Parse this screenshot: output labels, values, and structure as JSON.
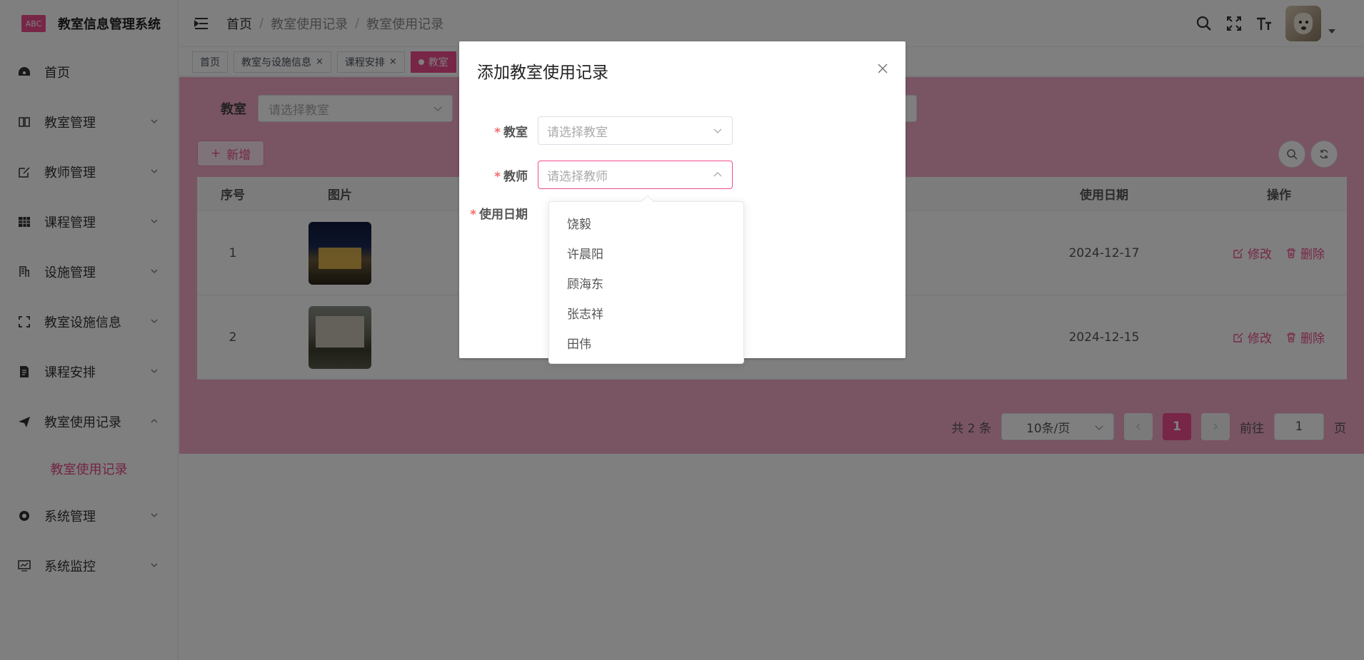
{
  "app": {
    "logo_text": "ABC",
    "title": "教室信息管理系统"
  },
  "sidebar": {
    "items": [
      {
        "label": "首页",
        "icon": "dashboard-icon"
      },
      {
        "label": "教室管理",
        "icon": "book-icon"
      },
      {
        "label": "教师管理",
        "icon": "edit-icon"
      },
      {
        "label": "课程管理",
        "icon": "grid-icon"
      },
      {
        "label": "设施管理",
        "icon": "building-icon"
      },
      {
        "label": "教室设施信息",
        "icon": "fullscreen-icon"
      },
      {
        "label": "课程安排",
        "icon": "document-icon"
      },
      {
        "label": "教室使用记录",
        "icon": "paper-plane-icon"
      },
      {
        "label": "系统管理",
        "icon": "gear-icon"
      },
      {
        "label": "系统监控",
        "icon": "monitor-icon"
      }
    ],
    "submenu_active": "教室使用记录"
  },
  "header": {
    "breadcrumb": [
      "首页",
      "/",
      "教室使用记录",
      "/",
      "教室使用记录"
    ]
  },
  "tags": [
    {
      "label": "首页"
    },
    {
      "label": "教室与设施信息",
      "close": "×"
    },
    {
      "label": "课程安排",
      "close": "×"
    },
    {
      "label": "教室",
      "active": true
    }
  ],
  "filter": {
    "label": "教室",
    "placeholder": "请选择教室"
  },
  "toolbar": {
    "add_label": "新增",
    "add_prefix": "+"
  },
  "table": {
    "headers": {
      "index": "序号",
      "image": "图片",
      "date": "使用日期",
      "ops": "操作"
    },
    "rows": [
      {
        "index": "1",
        "date": "2024-12-17"
      },
      {
        "index": "2",
        "date": "2024-12-15"
      }
    ],
    "edit_label": "修改",
    "delete_label": "删除"
  },
  "pagination": {
    "total": "共 2 条",
    "page_size": "10条/页",
    "current": "1",
    "goto_prefix": "前往",
    "goto_value": "1",
    "goto_suffix": "页"
  },
  "dialog": {
    "title": "添加教室使用记录",
    "fields": {
      "classroom": {
        "label": "教室",
        "placeholder": "请选择教室"
      },
      "teacher": {
        "label": "教师",
        "placeholder": "请选择教师"
      },
      "date": {
        "label": "使用日期"
      }
    },
    "required_mark": "*"
  },
  "dropdown": {
    "options": [
      "饶毅",
      "许晨阳",
      "顾海东",
      "张志祥",
      "田伟"
    ]
  },
  "colors": {
    "accent": "#ee4d8e",
    "required": "#f56c6c"
  }
}
